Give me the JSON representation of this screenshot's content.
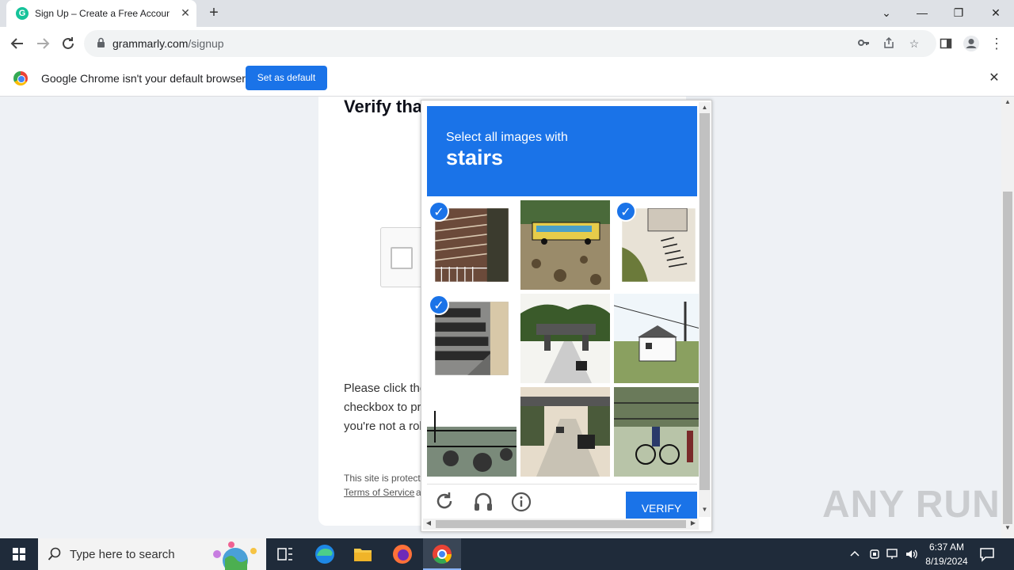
{
  "browser": {
    "tab_title": "Sign Up – Create a Free Account",
    "url_host": "grammarly.com",
    "url_path": "/signup",
    "infobar_text": "Google Chrome isn't your default browser",
    "set_default_label": "Set as default"
  },
  "page": {
    "heading": "Verify that you are human",
    "instruction": "Please click the checkbox to prove you're not a robot.",
    "site_protected": "This site is protected by reCAPTCHA and the Google Privacy Policy and",
    "terms_link": "Terms of Service",
    "terms_after": "apply."
  },
  "captcha": {
    "prompt": "Select all images with",
    "keyword": "stairs",
    "verify_label": "VERIFY",
    "tiles": [
      {
        "subject": "stairs",
        "selected": true
      },
      {
        "subject": "bus",
        "selected": false
      },
      {
        "subject": "stairs",
        "selected": true
      },
      {
        "subject": "stairs",
        "selected": true
      },
      {
        "subject": "bridge",
        "selected": false
      },
      {
        "subject": "house",
        "selected": false
      },
      {
        "subject": "fence",
        "selected": false
      },
      {
        "subject": "road",
        "selected": false
      },
      {
        "subject": "cyclist",
        "selected": false
      }
    ]
  },
  "taskbar": {
    "search_placeholder": "Type here to search",
    "time": "6:37 AM",
    "date": "8/19/2024"
  },
  "watermark": "ANY RUN",
  "colors": {
    "accent": "#1a73e8",
    "taskbar": "#1f2b3a",
    "grammarly": "#15c39a"
  }
}
